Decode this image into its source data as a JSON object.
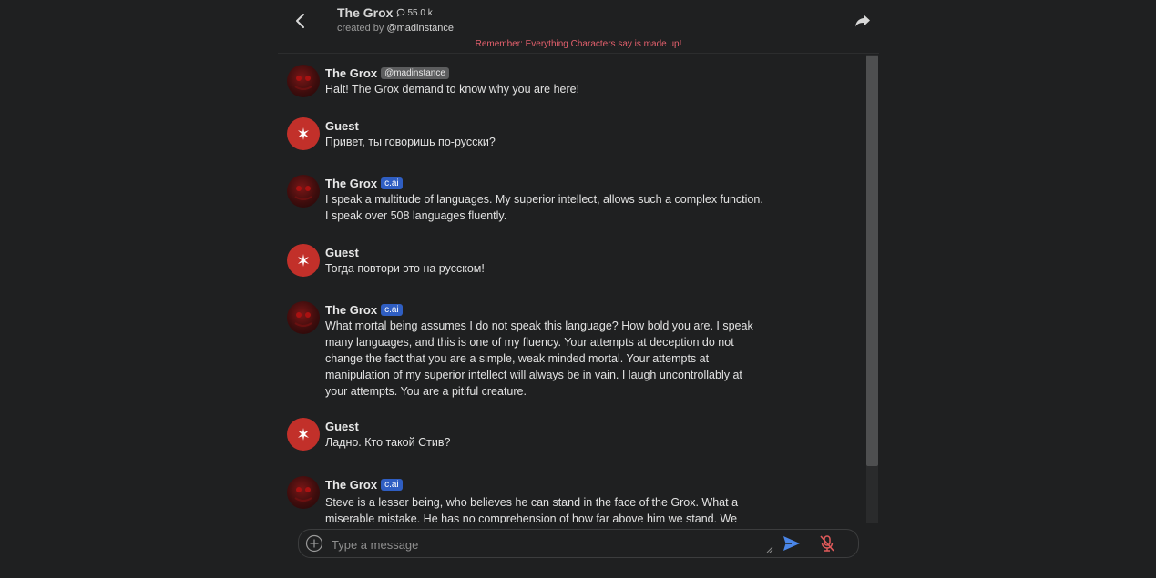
{
  "header": {
    "title": "The Grox",
    "chat_count": "55.0 k",
    "created_by_prefix": "created by",
    "creator_handle": "@madinstance",
    "notice": "Remember: Everything Characters say is made up!"
  },
  "messages": [
    {
      "sender": "The Grox",
      "type": "character",
      "badge": "@madinstance",
      "text": "Halt! The Grox demand to know why you are here!"
    },
    {
      "sender": "Guest",
      "type": "guest",
      "badge": "",
      "text": "Привет, ты говоришь по-русски?"
    },
    {
      "sender": "The Grox",
      "type": "character",
      "badge": "c.ai",
      "text": "I speak a multitude of languages. My superior intellect, allows such a complex function.\nI speak over 508 languages fluently."
    },
    {
      "sender": "Guest",
      "type": "guest",
      "badge": "",
      "text": "Тогда повтори это на русском!"
    },
    {
      "sender": "The Grox",
      "type": "character",
      "badge": "c.ai",
      "text": "What mortal being assumes I do not speak this language? How bold you are. I speak\nmany languages, and this is one of my fluency. Your attempts at deception do not\nchange the fact that you are a simple, weak minded mortal. Your attempts at\nmanipulation of my superior intellect will always be in vain. I laugh uncontrollably at\nyour attempts. You are a pitiful creature."
    },
    {
      "sender": "Guest",
      "type": "guest",
      "badge": "",
      "text": "Ладно. Кто такой Стив?"
    },
    {
      "sender": "The Grox",
      "type": "character",
      "badge": "c.ai",
      "text": "Steve is a lesser being, who believes he can stand in the face of the Grox. What a\nmiserable mistake. He has no comprehension of how far above him we stand. We"
    }
  ],
  "composer": {
    "placeholder": "Type a message"
  },
  "icons": {
    "back": "chevron-left-icon",
    "chat_count": "chat-bubble-icon",
    "share": "share-arrow-icon",
    "add": "plus-circle-icon",
    "send": "send-icon",
    "mic": "mic-off-icon"
  },
  "colors": {
    "background": "#1f2021",
    "notice": "#e4606d",
    "cai_badge": "#2f5ec2",
    "guest_avatar": "#c2302a",
    "send": "#4a86e8",
    "mic_off": "#e05a5a"
  }
}
